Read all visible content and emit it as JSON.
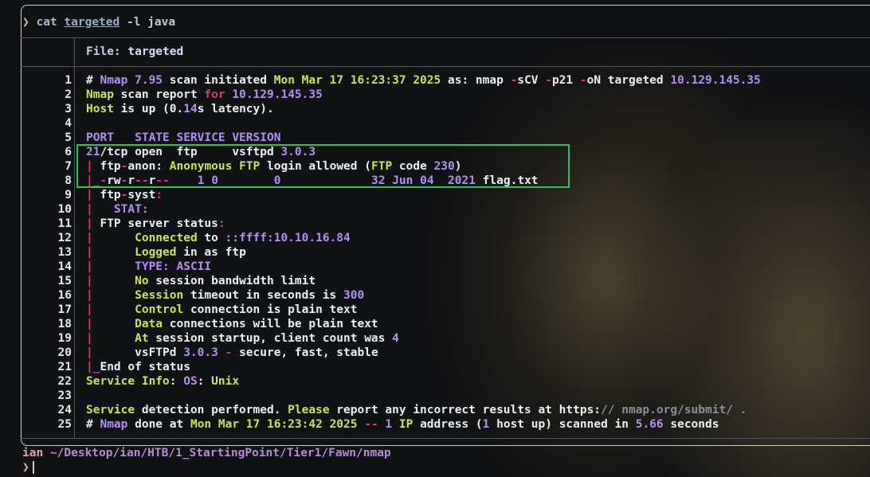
{
  "command": {
    "caret": "❯",
    "name": "cat",
    "file": "targeted",
    "flags": "-l java"
  },
  "file_header": {
    "label": "File: ",
    "name": "targeted"
  },
  "colors": {
    "white": "#eceff4",
    "yellow": "#c5e84f",
    "purple": "#b48ef5",
    "red": "#e0386f",
    "grey": "#8a8f99",
    "green_highlight": "#22c55e"
  },
  "lines": [
    [
      [
        "# ",
        "white"
      ],
      [
        "Nmap",
        "purple"
      ],
      [
        " 7.95",
        "purple"
      ],
      [
        " scan initiated ",
        "white"
      ],
      [
        "Mon Mar 17 16:23:37 2025",
        "yellow"
      ],
      [
        " as",
        ""
      ],
      [
        ": nmap ",
        "white"
      ],
      [
        "-",
        "red"
      ],
      [
        "sCV ",
        "white"
      ],
      [
        "-",
        "red"
      ],
      [
        "p21 ",
        "white"
      ],
      [
        "-",
        "red"
      ],
      [
        "oN targeted ",
        "white"
      ],
      [
        "10.129.145.35",
        "purple"
      ]
    ],
    [
      [
        "Nmap",
        "yellow"
      ],
      [
        " scan report ",
        "white"
      ],
      [
        "for",
        "red"
      ],
      [
        " 10.129.145.35",
        "purple"
      ]
    ],
    [
      [
        "Host",
        "yellow"
      ],
      [
        " is up (0.",
        "white"
      ],
      [
        "14",
        "purple"
      ],
      [
        "s latency).",
        "white"
      ]
    ],
    [],
    [
      [
        "PORT   STATE SERVICE VERSION",
        "purple"
      ]
    ],
    [
      [
        "21",
        "purple"
      ],
      [
        "/tcp open  ftp     vsftpd ",
        "white"
      ],
      [
        "3.0.3",
        "purple"
      ]
    ],
    [
      [
        "| ",
        "red"
      ],
      [
        "ftp",
        "white"
      ],
      [
        "-",
        "red"
      ],
      [
        "anon",
        "white"
      ],
      [
        ": ",
        "white"
      ],
      [
        "Anonymous FTP",
        "yellow"
      ],
      [
        " login allowed (",
        "white"
      ],
      [
        "FTP",
        "yellow"
      ],
      [
        " code ",
        "white"
      ],
      [
        "230",
        "purple"
      ],
      [
        ")",
        "white"
      ]
    ],
    [
      [
        "|_",
        "red"
      ],
      [
        "-",
        "red"
      ],
      [
        "rw",
        "white"
      ],
      [
        "-",
        "red"
      ],
      [
        "r",
        "white"
      ],
      [
        "--",
        "red"
      ],
      [
        "r",
        "white"
      ],
      [
        "--",
        "red"
      ],
      [
        "    ",
        "white"
      ],
      [
        "1 0",
        "purple"
      ],
      [
        "        ",
        "white"
      ],
      [
        "0",
        "purple"
      ],
      [
        "             ",
        "white"
      ],
      [
        "32 Jun 04  2021",
        "purple"
      ],
      [
        " flag.txt",
        "white"
      ]
    ],
    [
      [
        "| ",
        "red"
      ],
      [
        "ftp",
        "white"
      ],
      [
        "-",
        "red"
      ],
      [
        "syst",
        "white"
      ],
      [
        ":",
        "red"
      ]
    ],
    [
      [
        "|   ",
        "red"
      ],
      [
        "STAT:",
        "purple"
      ]
    ],
    [
      [
        "| ",
        "red"
      ],
      [
        "FTP server status",
        "white"
      ],
      [
        ":",
        "red"
      ]
    ],
    [
      [
        "|      ",
        "red"
      ],
      [
        "Connected",
        "yellow"
      ],
      [
        " to ",
        "white"
      ],
      [
        "::ffff:10.10.16.84",
        "purple"
      ]
    ],
    [
      [
        "|      ",
        "red"
      ],
      [
        "Logged",
        "yellow"
      ],
      [
        " in as ftp",
        "white"
      ]
    ],
    [
      [
        "|      ",
        "red"
      ],
      [
        "TYPE:",
        "purple"
      ],
      [
        " ASCII",
        "purple"
      ]
    ],
    [
      [
        "|      ",
        "red"
      ],
      [
        "No",
        "yellow"
      ],
      [
        " session bandwidth limit",
        "white"
      ]
    ],
    [
      [
        "|      ",
        "red"
      ],
      [
        "Session",
        "yellow"
      ],
      [
        " timeout in seconds is ",
        "white"
      ],
      [
        "300",
        "purple"
      ]
    ],
    [
      [
        "|      ",
        "red"
      ],
      [
        "Control",
        "yellow"
      ],
      [
        " connection is plain text",
        "white"
      ]
    ],
    [
      [
        "|      ",
        "red"
      ],
      [
        "Data",
        "yellow"
      ],
      [
        " connections will be plain text",
        "white"
      ]
    ],
    [
      [
        "|      ",
        "red"
      ],
      [
        "At",
        "yellow"
      ],
      [
        " session startup, client count was ",
        "white"
      ],
      [
        "4",
        "purple"
      ]
    ],
    [
      [
        "|      ",
        "red"
      ],
      [
        "vsFTPd ",
        "white"
      ],
      [
        "3.0.3",
        "purple"
      ],
      [
        " - ",
        "red"
      ],
      [
        "secure, fast, stable",
        "white"
      ]
    ],
    [
      [
        "|_",
        "red"
      ],
      [
        "End of status",
        "white"
      ]
    ],
    [
      [
        "Service Info",
        "yellow"
      ],
      [
        ": ",
        "white"
      ],
      [
        "OS",
        "purple"
      ],
      [
        ": ",
        "white"
      ],
      [
        "Unix",
        "yellow"
      ]
    ],
    [],
    [
      [
        "Service",
        "yellow"
      ],
      [
        " detection performed. ",
        "white"
      ],
      [
        "Please",
        "yellow"
      ],
      [
        " report any incorrect results at https:",
        "white"
      ],
      [
        "//",
        "grey"
      ],
      [
        " nmap.org/submit/ .",
        "grey"
      ]
    ],
    [
      [
        "# ",
        "white"
      ],
      [
        "Nmap",
        "purple"
      ],
      [
        " done at ",
        "white"
      ],
      [
        "Mon Mar 17 16:23:42 2025",
        "yellow"
      ],
      [
        " -- ",
        "red"
      ],
      [
        "1",
        "purple"
      ],
      [
        " IP",
        "yellow"
      ],
      [
        " address (",
        "white"
      ],
      [
        "1",
        "purple"
      ],
      [
        " host up) scanned in ",
        "white"
      ],
      [
        "5.66",
        "purple"
      ],
      [
        " seconds",
        "white"
      ]
    ]
  ],
  "line_numbers": [
    "1",
    "2",
    "3",
    "4",
    "5",
    "6",
    "7",
    "8",
    "9",
    "10",
    "11",
    "12",
    "13",
    "14",
    "15",
    "16",
    "17",
    "18",
    "19",
    "20",
    "21",
    "22",
    "23",
    "24",
    "25"
  ],
  "status": {
    "user": "ian",
    "path": " ~/Desktop/ian/HTB/1_StartingPoint/Tier1/Fawn/nmap"
  },
  "prompt": {
    "caret": "❯"
  }
}
